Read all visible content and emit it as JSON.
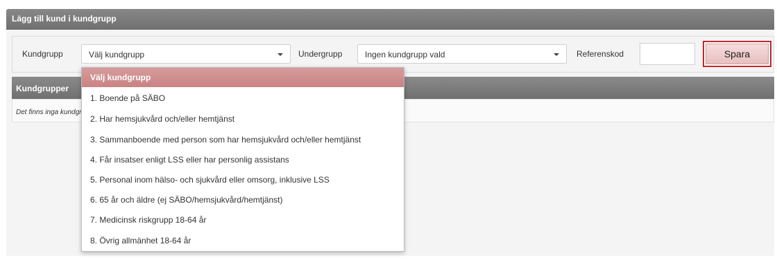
{
  "header": {
    "title": "Lägg till kund i kundgrupp"
  },
  "form": {
    "kundgrupp_label": "Kundgrupp",
    "kundgrupp_value": "Välj kundgrupp",
    "undergrupp_label": "Undergrupp",
    "undergrupp_value": "Ingen kundgrupp vald",
    "referenskod_label": "Referenskod",
    "referenskod_value": "",
    "save_label": "Spara"
  },
  "section": {
    "title": "Kundgrupper",
    "empty_text": "Det finns inga kundgrupper"
  },
  "dropdown": {
    "items": [
      "Välj kundgrupp",
      "1. Boende på SÄBO",
      "2. Har hemsjukvård och/eller hemtjänst",
      "3. Sammanboende med person som har hemsjukvård och/eller hemtjänst",
      "4. Får insatser enligt LSS eller har personlig assistans",
      "5. Personal inom hälso- och sjukvård eller omsorg, inklusive LSS",
      "6. 65 år och äldre (ej SÄBO/hemsjukvård/hemtjänst)",
      "7. Medicinsk riskgrupp 18-64 år",
      "8. Övrig allmänhet 18-64 år"
    ],
    "highlighted_index": 0
  },
  "colors": {
    "header_bg": "#7d7d7d",
    "highlight": "#d08f8f",
    "save_border": "#c8242c"
  }
}
